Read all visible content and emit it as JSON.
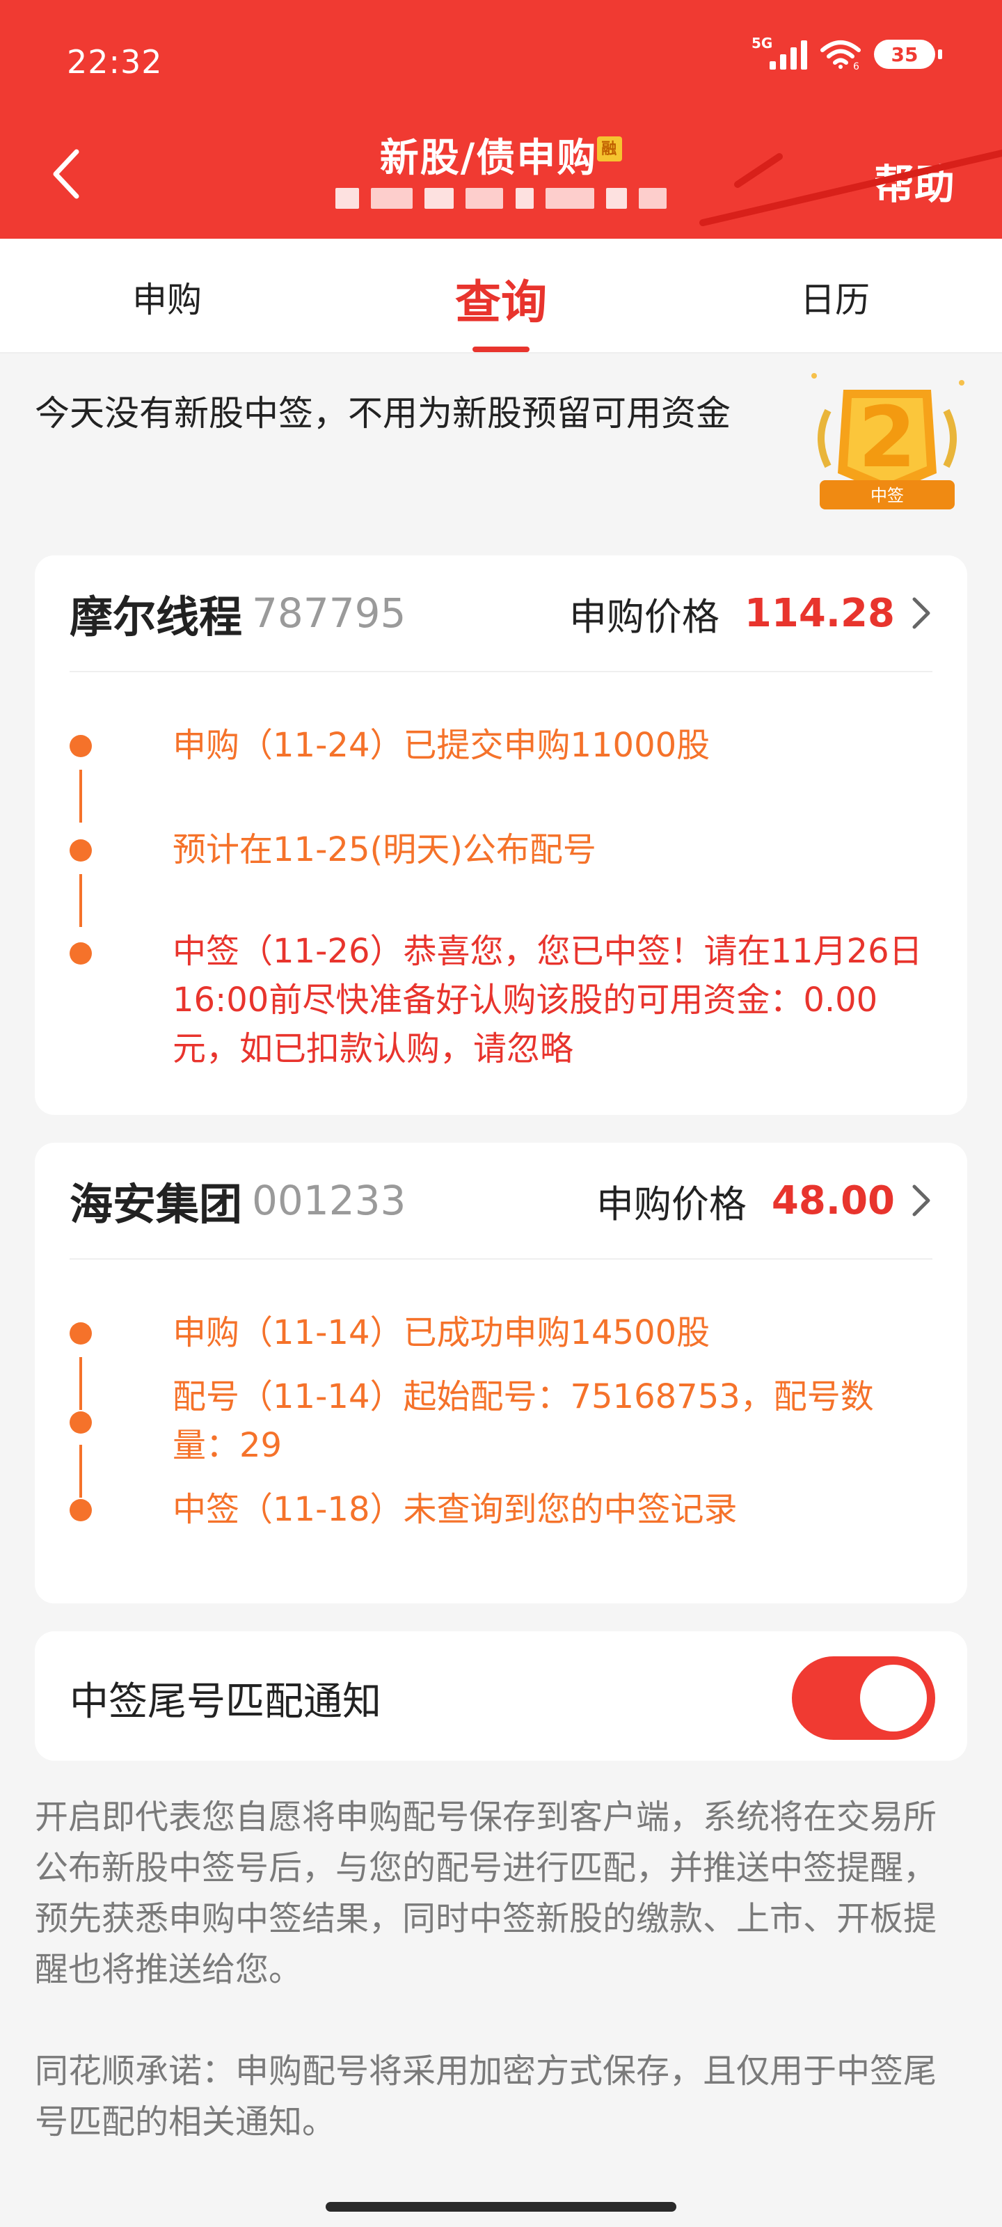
{
  "status_bar": {
    "time": "22:32",
    "network": "5G",
    "wifi_sub": "6",
    "battery": "35"
  },
  "header": {
    "title": "新股/债申购",
    "title_badge": "融",
    "help_label": "帮助"
  },
  "tabs": [
    {
      "label": "申购",
      "active": false
    },
    {
      "label": "查询",
      "active": true
    },
    {
      "label": "日历",
      "active": false
    }
  ],
  "notice": {
    "text": "今天没有新股中签，不用为新股预留可用资金",
    "medal_label": "中签",
    "medal_number": "2"
  },
  "stocks": [
    {
      "name": "摩尔线程",
      "code": "787795",
      "price_label": "申购价格",
      "price": "114.28",
      "events": [
        {
          "text": "申购（11-24）已提交申购11000股",
          "color": "#f5722a"
        },
        {
          "text": "预计在11-25(明天)公布配号",
          "color": "#f5722a"
        },
        {
          "text": "中签（11-26）恭喜您，您已中签！请在11月26日16:00前尽快准备好认购该股的可用资金：0.00元，如已扣款认购，请忽略",
          "color": "#e8342d"
        }
      ]
    },
    {
      "name": "海安集团",
      "code": "001233",
      "price_label": "申购价格",
      "price": "48.00",
      "events": [
        {
          "text": "申购（11-14）已成功申购14500股",
          "color": "#f5722a"
        },
        {
          "text": "配号（11-14）起始配号：75168753，配号数量：29",
          "color": "#f5722a"
        },
        {
          "text": "中签（11-18）未查询到您的中签记录",
          "color": "#f5722a"
        }
      ]
    }
  ],
  "toggle": {
    "label": "中签尾号匹配通知",
    "on": true
  },
  "descriptions": [
    "开启即代表您自愿将申购配号保存到客户端，系统将在交易所公布新股中签号后，与您的配号进行匹配，并推送中签提醒，预先获悉申购中签结果，同时中签新股的缴款、上市、开板提醒也将推送给您。",
    "同花顺承诺：申购配号将采用加密方式保存，且仅用于中签尾号匹配的相关通知。"
  ],
  "colors": {
    "brand": "#f03a32",
    "accent_red": "#e8342d",
    "timeline_orange": "#f5722a"
  }
}
